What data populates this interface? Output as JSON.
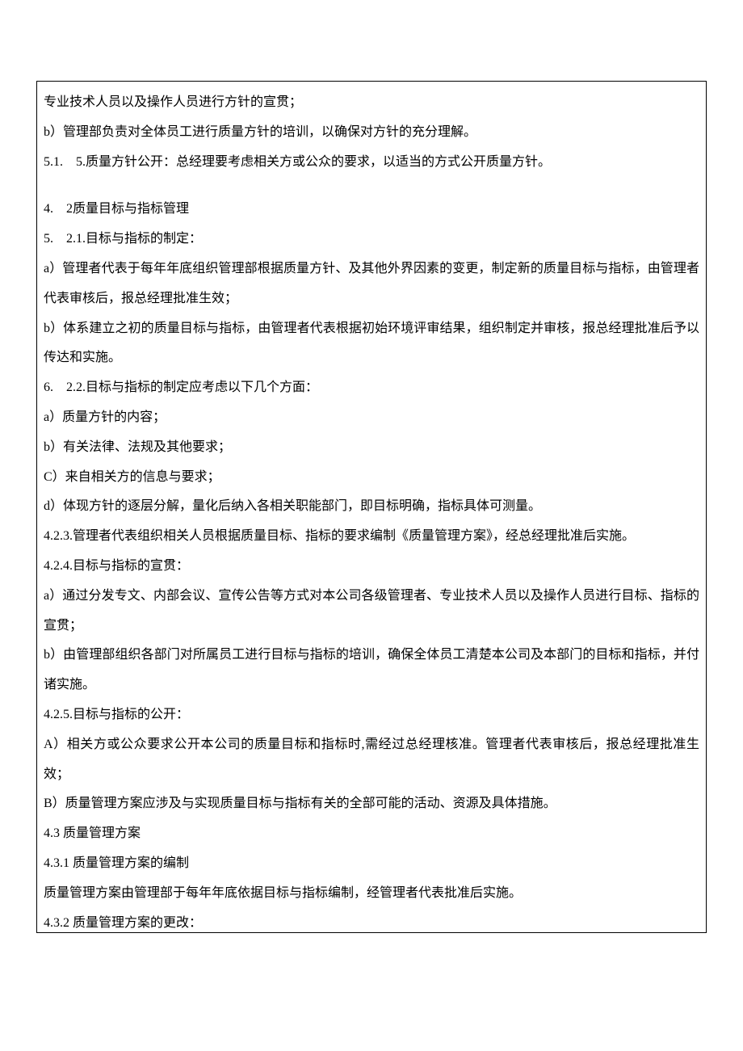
{
  "lines": [
    "专业技术人员以及操作人员进行方针的宣贯；",
    "b）管理部负责对全体员工进行质量方针的培训，以确保对方针的充分理解。",
    "5.1.　5.质量方针公开：总经理要考虑相关方或公众的要求，以适当的方式公开质量方针。",
    "",
    "4.　2质量目标与指标管理",
    "5.　2.1.目标与指标的制定：",
    "a）管理者代表于每年年底组织管理部根据质量方针、及其他外界因素的变更，制定新的质量目标与指标，由管理者代表审核后，报总经理批准生效；",
    "b）体系建立之初的质量目标与指标，由管理者代表根据初始环境评审结果，组织制定并审核，报总经理批准后予以传达和实施。",
    "6.　2.2.目标与指标的制定应考虑以下几个方面：",
    "a）质量方针的内容；",
    "b）有关法律、法规及其他要求；",
    "C）来自相关方的信息与要求；",
    "d）体现方针的逐层分解，量化后纳入各相关职能部门，即目标明确，指标具体可测量。",
    "4.2.3.管理者代表组织相关人员根据质量目标、指标的要求编制《质量管理方案》，经总经理批准后实施。",
    "4.2.4.目标与指标的宣贯：",
    "a）通过分发专文、内部会议、宣传公告等方式对本公司各级管理者、专业技术人员以及操作人员进行目标、指标的宣贯；",
    "b）由管理部组织各部门对所属员工进行目标与指标的培训，确保全体员工清楚本公司及本部门的目标和指标，并付诸实施。",
    "4.2.5.目标与指标的公开：",
    "A）相关方或公众要求公开本公司的质量目标和指标时,需经过总经理核准。管理者代表审核后，报总经理批准生效；",
    "B）质量管理方案应涉及与实现质量目标与指标有关的全部可能的活动、资源及具体措施。",
    "4.3 质量管理方案",
    "4.3.1 质量管理方案的编制",
    "质量管理方案由管理部于每年年底依据目标与指标编制，经管理者代表批准后实施。",
    "4.3.2 质量管理方案的更改："
  ]
}
